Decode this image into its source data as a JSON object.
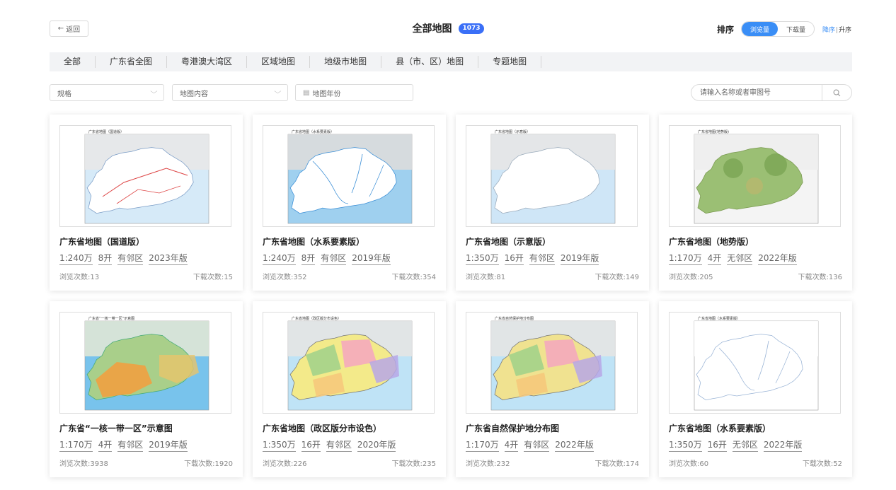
{
  "header": {
    "back_label": "返回",
    "title": "全部地图",
    "count": "1073",
    "sort_label": "排序",
    "sort_views": "浏览量",
    "sort_downloads": "下载量",
    "order_desc": "降序",
    "order_sep": "|",
    "order_asc": "升序"
  },
  "categories": [
    "全部",
    "广东省全图",
    "粤港澳大湾区",
    "区域地图",
    "地级市地图",
    "县（市、区）地图",
    "专题地图"
  ],
  "filters": {
    "scale": "规格",
    "content": "地图内容",
    "year": "地图年份",
    "search_placeholder": "请输入名称或者审图号"
  },
  "colors": {
    "accent": "#3a8ef6",
    "badge": "#3a6ff7"
  },
  "cards": [
    {
      "title": "广东省地图（国道版）",
      "scale": "1:240万",
      "size": "8开",
      "neighbor": "有邻区",
      "year": "2023年版",
      "views": "浏览次数:13",
      "downloads": "下载次数:15",
      "map_caption": "广东省地图（国道版）",
      "style": "road"
    },
    {
      "title": "广东省地图（水系要素版）",
      "scale": "1:240万",
      "size": "8开",
      "neighbor": "有邻区",
      "year": "2019年版",
      "views": "浏览次数:352",
      "downloads": "下载次数:354",
      "map_caption": "广东省地图（水系要素版）",
      "style": "water"
    },
    {
      "title": "广东省地图（示意版）",
      "scale": "1:350万",
      "size": "16开",
      "neighbor": "有邻区",
      "year": "2019年版",
      "views": "浏览次数:81",
      "downloads": "下载次数:149",
      "map_caption": "广东省地图（示意版）",
      "style": "schematic"
    },
    {
      "title": "广东省地图（地势版）",
      "scale": "1:170万",
      "size": "4开",
      "neighbor": "无邻区",
      "year": "2022年版",
      "views": "浏览次数:205",
      "downloads": "下载次数:136",
      "map_caption": "广东省地图(地势版)",
      "style": "terrain"
    },
    {
      "title": "广东省“一核一带一区”示意图",
      "scale": "1:170万",
      "size": "4开",
      "neighbor": "有邻区",
      "year": "2019年版",
      "views": "浏览次数:3938",
      "downloads": "下载次数:1920",
      "map_caption": "广东省“一核一带一区”示意图",
      "style": "zones"
    },
    {
      "title": "广东省地图（政区版分市设色）",
      "scale": "1:350万",
      "size": "16开",
      "neighbor": "有邻区",
      "year": "2020年版",
      "views": "浏览次数:226",
      "downloads": "下载次数:235",
      "map_caption": "广东省地图（政区版分市设色）",
      "style": "political"
    },
    {
      "title": "广东省自然保护地分布图",
      "scale": "1:170万",
      "size": "4开",
      "neighbor": "有邻区",
      "year": "2022年版",
      "views": "浏览次数:232",
      "downloads": "下载次数:174",
      "map_caption": "广东省自然保护地分布图",
      "style": "reserve"
    },
    {
      "title": "广东省地图（水系要素版）",
      "scale": "1:350万",
      "size": "16开",
      "neighbor": "无邻区",
      "year": "2022年版",
      "views": "浏览次数:60",
      "downloads": "下载次数:52",
      "map_caption": "广东省地图（水系要素版）",
      "style": "outline"
    }
  ]
}
